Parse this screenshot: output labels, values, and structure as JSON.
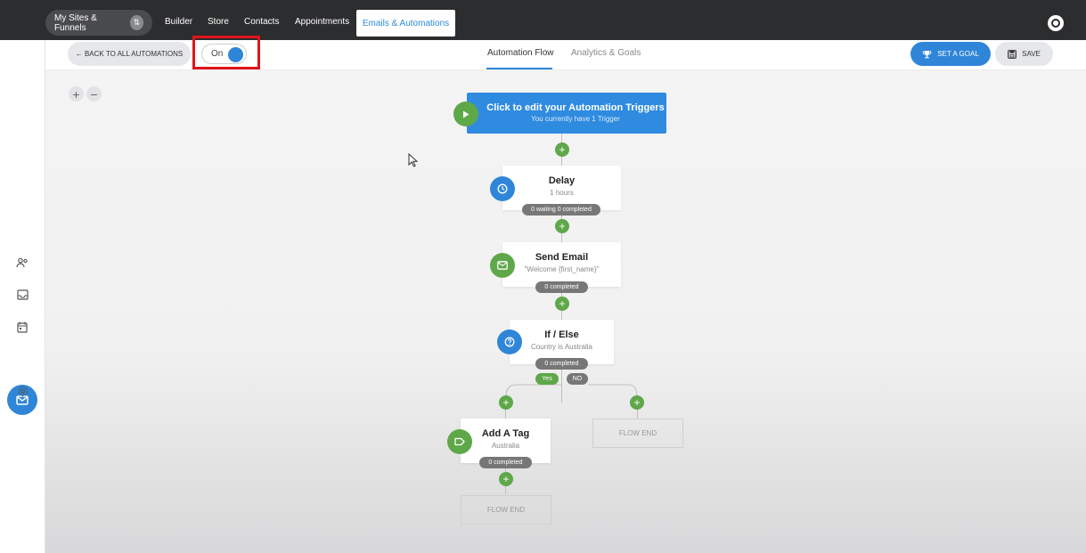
{
  "topnav": {
    "sites_funnels": "My Sites & Funnels",
    "sites_badge": "⇅",
    "builder": "Builder",
    "store": "Store",
    "contacts": "Contacts",
    "appointments": "Appointments",
    "emails_automations": "Emails & Automations"
  },
  "toolbar": {
    "back_label": "← BACK TO ALL AUTOMATIONS",
    "toggle_label": "On",
    "toggle_state": "on",
    "tab_flow": "Automation Flow",
    "tab_analytics": "Analytics & Goals",
    "goal_label": "SET A GOAL",
    "save_label": "SAVE"
  },
  "zoom": {
    "in": "+",
    "out": "−"
  },
  "flow": {
    "trigger": {
      "title": "Click to edit your Automation Triggers",
      "subtitle": "You currently have 1 Trigger"
    },
    "delay": {
      "title": "Delay",
      "subtitle": "1 hours",
      "stats": "0 waiting  0 completed"
    },
    "send_email": {
      "title": "Send Email",
      "subtitle": "\"Welcome {first_name}\"",
      "stats": "0 completed"
    },
    "if_else": {
      "title": "If / Else",
      "subtitle": "Country is Australia",
      "stats": "0 completed",
      "yes": "Yes",
      "no": "NO"
    },
    "add_tag": {
      "title": "Add A Tag",
      "subtitle": "Australia",
      "stats": "0 completed"
    },
    "flow_end_yes": "FLOW END",
    "flow_end_no": "FLOW END"
  },
  "colors": {
    "primary": "#2f86d8",
    "success": "#5ea849",
    "highlight": "#e0151b"
  }
}
